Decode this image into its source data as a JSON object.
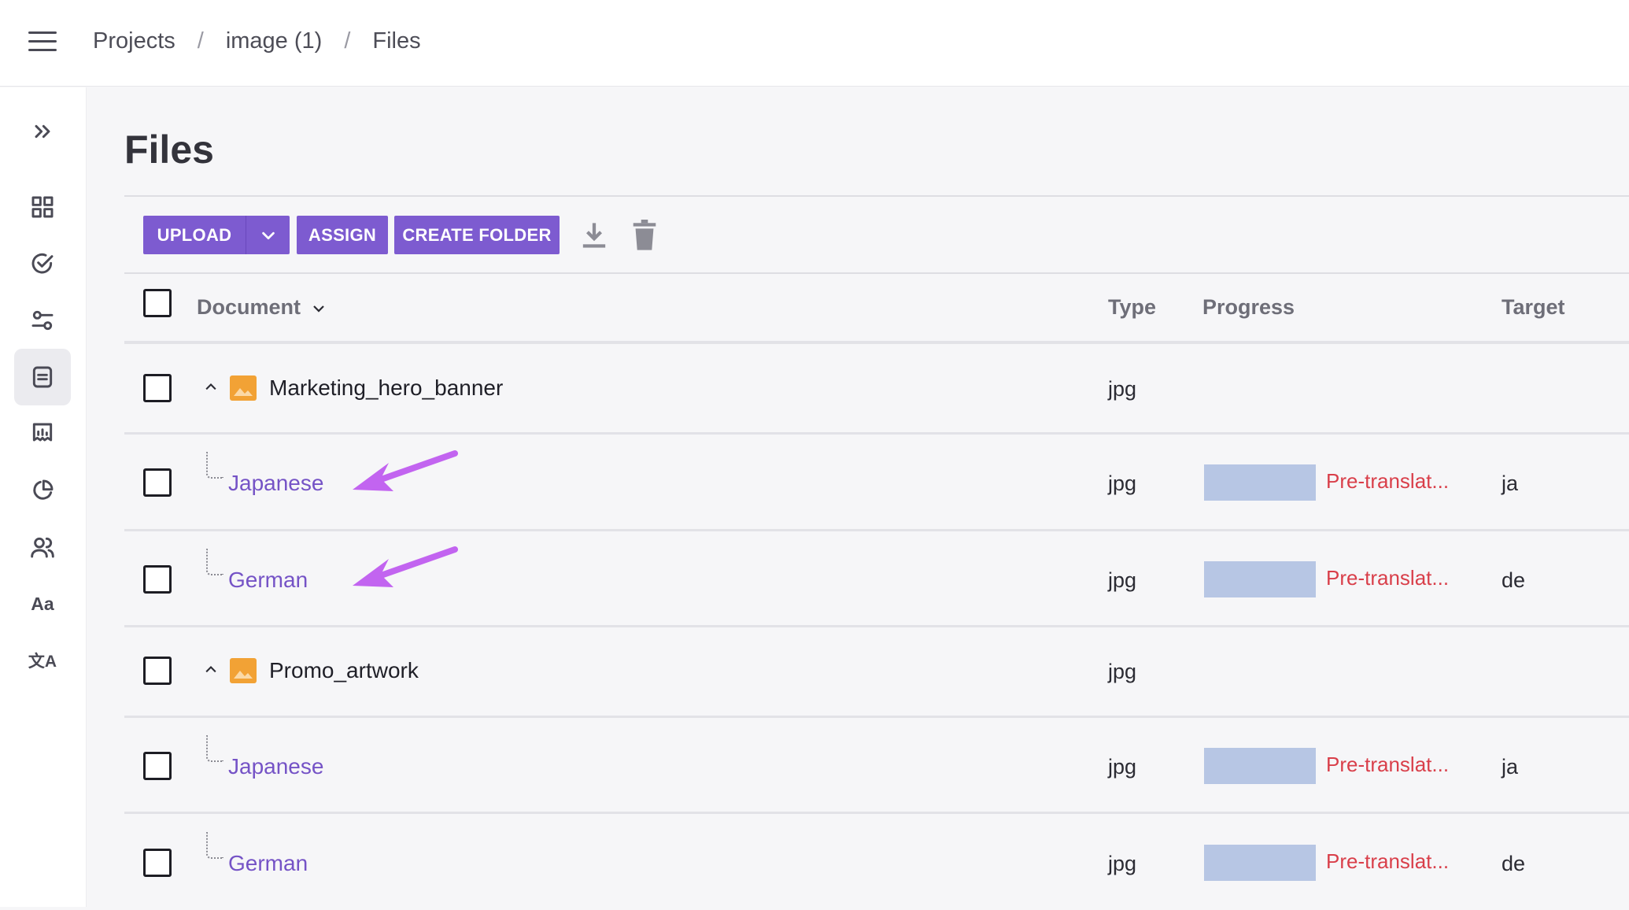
{
  "breadcrumb": {
    "items": [
      "Projects",
      "image (1)",
      "Files"
    ],
    "separator": "/"
  },
  "page": {
    "title": "Files"
  },
  "toolbar": {
    "upload_label": "UPLOAD",
    "assign_label": "ASSIGN",
    "create_folder_label": "CREATE FOLDER"
  },
  "table": {
    "columns": {
      "document": "Document",
      "type": "Type",
      "progress": "Progress",
      "target": "Target"
    },
    "rows": [
      {
        "kind": "parent",
        "name": "Marketing_hero_banner",
        "type": "jpg"
      },
      {
        "kind": "child",
        "name": "Japanese",
        "type": "jpg",
        "status": "Pre-translat...",
        "target": "ja"
      },
      {
        "kind": "child",
        "name": "German",
        "type": "jpg",
        "status": "Pre-translat...",
        "target": "de"
      },
      {
        "kind": "parent",
        "name": "Promo_artwork",
        "type": "jpg"
      },
      {
        "kind": "child",
        "name": "Japanese",
        "type": "jpg",
        "status": "Pre-translat...",
        "target": "ja"
      },
      {
        "kind": "child",
        "name": "German",
        "type": "jpg",
        "status": "Pre-translat...",
        "target": "de"
      }
    ]
  },
  "sidebar": {
    "items": [
      "expand-icon",
      "dashboard-icon",
      "tasks-icon",
      "settings-sliders-icon",
      "files-icon",
      "reports-icon",
      "analytics-icon",
      "members-icon",
      "glossary-icon",
      "translation-memory-icon"
    ],
    "glossary_label": "Aa",
    "tm_label": "文A"
  },
  "colors": {
    "accent": "#7d5bd0",
    "link": "#7553c6",
    "status_error": "#d93f4a",
    "progress_fill": "#b7c6e4",
    "annotation_arrow": "#c264f0",
    "image_icon": "#f2a235"
  }
}
